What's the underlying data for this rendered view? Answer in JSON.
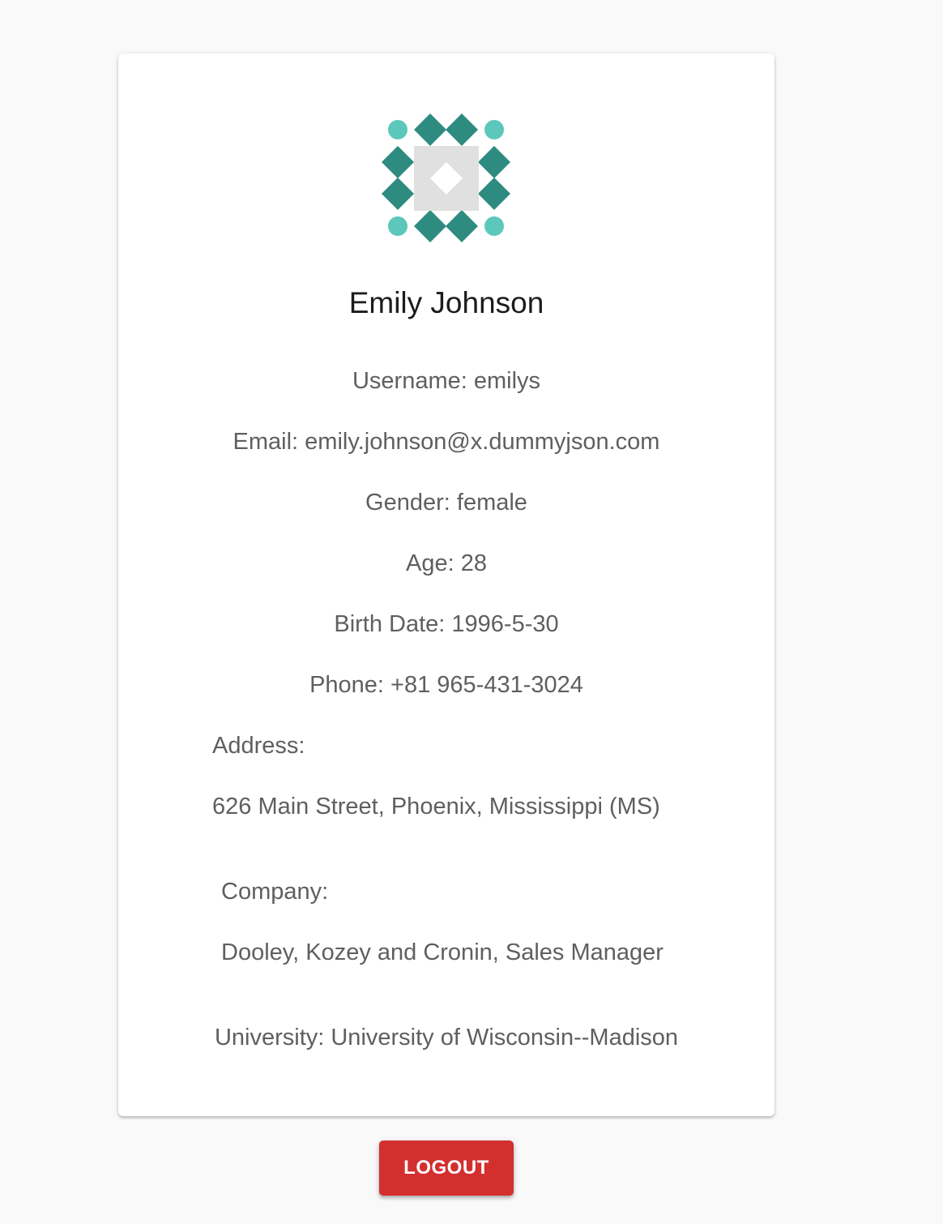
{
  "profile": {
    "avatar_icon": "identicon-avatar",
    "name": "Emily Johnson",
    "username": "Username: emilys",
    "email": "Email: emily.johnson@x.dummyjson.com",
    "gender": "Gender: female",
    "age": "Age: 28",
    "birth_date": "Birth Date: 1996-5-30",
    "phone": "Phone: +81 965-431-3024",
    "address_label": "Address:",
    "address_value": "626 Main Street, Phoenix, Mississippi (MS)",
    "company_label": "Company:",
    "company_value": "Dooley, Kozey and Cronin, Sales Manager",
    "university": "University: University of Wisconsin--Madison"
  },
  "actions": {
    "logout_label": "LOGOUT"
  },
  "colors": {
    "background": "#f9f9f9",
    "card": "#ffffff",
    "avatar_dark": "#2e8b80",
    "avatar_light": "#5cc7bb",
    "avatar_center": "#e0e0e0",
    "logout_button": "#d32f2f"
  }
}
